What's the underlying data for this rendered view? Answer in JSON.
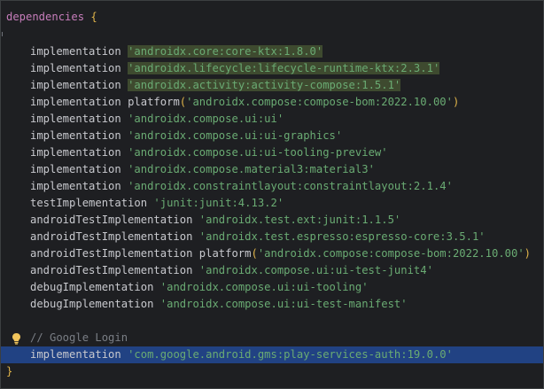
{
  "editor": {
    "language": "Gradle Kotlin DSL",
    "colors": {
      "background": "#1e1f22",
      "string": "#6aab73",
      "config": "#c77dbb",
      "bracket": "#e0b44a",
      "comment": "#7a7e85",
      "selection": "#214283",
      "highlight": "#3e4a2f"
    },
    "block_name": "dependencies",
    "open_brace": "{",
    "close_brace": "}",
    "lines": [
      {
        "kind": "impl",
        "config": "implementation",
        "value": "'androidx.core:core-ktx:1.8.0'",
        "highlight": true
      },
      {
        "kind": "impl",
        "config": "implementation",
        "value": "'androidx.lifecycle:lifecycle-runtime-ktx:2.3.1'",
        "highlight": true
      },
      {
        "kind": "impl",
        "config": "implementation",
        "value": "'androidx.activity:activity-compose:1.5.1'",
        "highlight": true
      },
      {
        "kind": "platform",
        "config": "implementation",
        "fn": "platform",
        "value": "'androidx.compose:compose-bom:2022.10.00'"
      },
      {
        "kind": "impl",
        "config": "implementation",
        "value": "'androidx.compose.ui:ui'"
      },
      {
        "kind": "impl",
        "config": "implementation",
        "value": "'androidx.compose.ui:ui-graphics'"
      },
      {
        "kind": "impl",
        "config": "implementation",
        "value": "'androidx.compose.ui:ui-tooling-preview'"
      },
      {
        "kind": "impl",
        "config": "implementation",
        "value": "'androidx.compose.material3:material3'"
      },
      {
        "kind": "impl",
        "config": "implementation",
        "value": "'androidx.constraintlayout:constraintlayout:2.1.4'"
      },
      {
        "kind": "impl",
        "config": "testImplementation",
        "value": "'junit:junit:4.13.2'"
      },
      {
        "kind": "impl",
        "config": "androidTestImplementation",
        "value": "'androidx.test.ext:junit:1.1.5'"
      },
      {
        "kind": "impl",
        "config": "androidTestImplementation",
        "value": "'androidx.test.espresso:espresso-core:3.5.1'"
      },
      {
        "kind": "platform",
        "config": "androidTestImplementation",
        "fn": "platform",
        "value": "'androidx.compose:compose-bom:2022.10.00'"
      },
      {
        "kind": "impl",
        "config": "androidTestImplementation",
        "value": "'androidx.compose.ui:ui-test-junit4'"
      },
      {
        "kind": "impl",
        "config": "debugImplementation",
        "value": "'androidx.compose.ui:ui-tooling'"
      },
      {
        "kind": "impl",
        "config": "debugImplementation",
        "value": "'androidx.compose.ui:ui-test-manifest'"
      }
    ],
    "comment_line": "// Google Login",
    "selected_line": {
      "config": "implementation",
      "value": "'com.google.android.gms:play-services-auth:19.0.0'"
    },
    "gutter_icon": "lightbulb-icon"
  }
}
